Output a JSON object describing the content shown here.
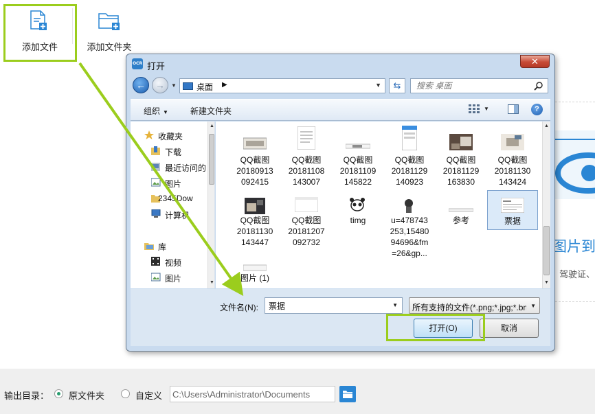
{
  "toolbar": {
    "add_file_label": "添加文件",
    "add_folder_label": "添加文件夹"
  },
  "background": {
    "title_partial": "图片到",
    "subtitle_partial": "驾驶证、"
  },
  "output": {
    "label": "输出目录：",
    "option_original": "原文件夹",
    "option_custom": "自定义",
    "selected": "原文件夹",
    "path_value": "C:\\Users\\Administrator\\Documents"
  },
  "dialog": {
    "title": "打开",
    "address": "桌面",
    "search_placeholder": "搜索 桌面",
    "organize": "组织",
    "new_folder": "新建文件夹",
    "help": "?",
    "nav": {
      "favorites": "收藏夹",
      "downloads": "下载",
      "recent": "最近访问的",
      "pictures": "图片",
      "download2345": "2345Dow",
      "computer": "计算机",
      "library": "库",
      "videos": "视频",
      "pictures2": "图片"
    },
    "files": [
      {
        "name": "QQ截图\n20180913\n092415"
      },
      {
        "name": "QQ截图\n20181108\n143007"
      },
      {
        "name": "QQ截图\n20181109\n145822"
      },
      {
        "name": "QQ截图\n20181129\n140923"
      },
      {
        "name": "QQ截图\n20181129\n163830"
      },
      {
        "name": "QQ截图\n20181130\n143424"
      },
      {
        "name": "QQ截图\n20181130\n143447"
      },
      {
        "name": "QQ截图\n20181207\n092732"
      },
      {
        "name": "timg"
      },
      {
        "name": "u=478743\n253,15480\n94696&fm\n=26&gp..."
      },
      {
        "name": "参考"
      },
      {
        "name": "票据"
      },
      {
        "name": "图片 (1)"
      }
    ],
    "selected_file": "票据",
    "filename_label": "文件名(N):",
    "filename_value": "票据",
    "filetype": "所有支持的文件(*.png;*.jpg;*.bmp)",
    "open_button": "打开(O)",
    "cancel_button": "取消"
  },
  "colors": {
    "highlight": "#9bcd1d",
    "accent": "#2a86d4"
  }
}
